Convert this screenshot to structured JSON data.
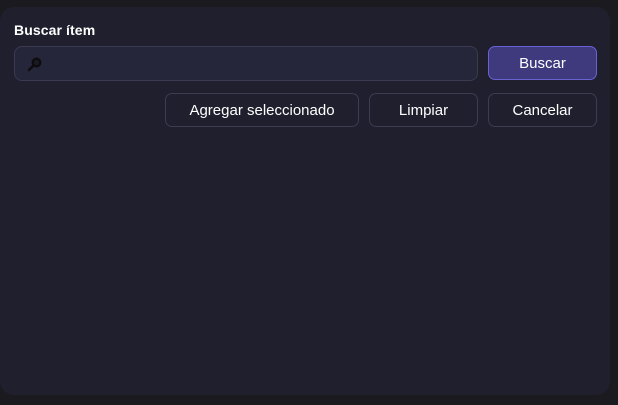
{
  "dialog": {
    "title": "Buscar ítem",
    "search": {
      "value": "",
      "placeholder": "",
      "icon": "magnifier-icon"
    },
    "buttons": {
      "search": "Buscar",
      "add_selected": "Agregar seleccionado",
      "clear": "Limpiar",
      "cancel": "Cancelar"
    }
  },
  "colors": {
    "background": "#1f1f2e",
    "primary_button": "#3f3a7e",
    "primary_border": "#6a62d4"
  }
}
